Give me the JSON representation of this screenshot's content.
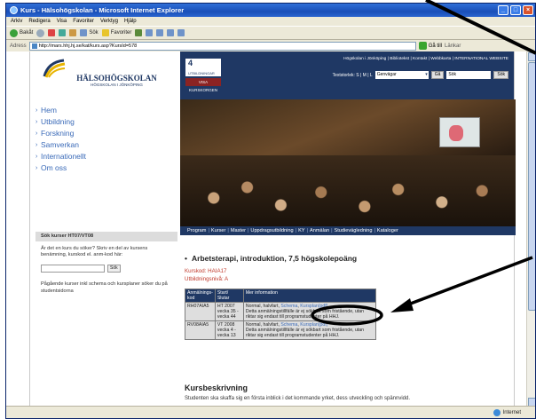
{
  "window": {
    "title": "Kurs - Hälsohögskolan - Microsoft Internet Explorer"
  },
  "menu": [
    "Arkiv",
    "Redigera",
    "Visa",
    "Favoriter",
    "Verktyg",
    "Hjälp"
  ],
  "toolbar": {
    "back": "Bakåt",
    "search": "Sök",
    "favorites": "Favoriter"
  },
  "addressbar": {
    "label": "Adress",
    "url": "http://mars.hhj.hj.se/kat/kurs.asp?KursId=578",
    "go": "Gå till",
    "links": "Länkar"
  },
  "header": {
    "logo_name": "HÄLSOHÖGSKOLAN",
    "logo_sub": "HÖGSKOLAN I JÖNKÖPING",
    "box_text": "4",
    "box_sub": "UTBILDNINGAR",
    "box2_text": "VISA KURSKORGEN",
    "toplinks": "Högskolan i Jönköping | Bibliotekst | Kontakt | Webbkarta | INTERNATIONAL WEBSITE",
    "textsize_label": "Textstorlek: S | M | L",
    "shortcut": "Genvägar",
    "go_button": "Gå",
    "search_value": "Sök",
    "search_button": "Sök"
  },
  "leftnav": [
    "Hem",
    "Utbildning",
    "Forskning",
    "Samverkan",
    "Internationellt",
    "Om oss"
  ],
  "subnav": [
    "Program",
    "Kurser",
    "Master",
    "Uppdragsutbildning",
    "KY",
    "Anmälan",
    "Studievägledning",
    "Kataloger"
  ],
  "sidebar": {
    "heading": "Sök kurser HT07/VT08",
    "text": "Är det en kurs du söker? Skriv en del av kursens benämning, kurskod el. anm-kod här:",
    "search_button": "Sök",
    "text2": "Pågående kurser inkl schema och kursplaner söker du på studentsidorna"
  },
  "course": {
    "title": "Arbetsterapi, introduktion, 7,5 högskolepoäng",
    "code": "Kurskod: HAIA17",
    "level": "Utbildningsnivå: A",
    "table_headers": [
      "Anmälnings-kod",
      "Start/ Slutar",
      "Mer information"
    ],
    "rows": [
      {
        "code": "RH07AIA5",
        "period": "HT 2007 vecka 35 - vecka 44",
        "info_prefix": "Normal, halvfart, ",
        "link_schema": "Schema",
        "link_kursplan": "Kursplan(pdf)",
        "info_text": "Detta anmälningstillfälle är ej sökbart som fristående, utan riktar sig endast till programstudenter på HHJ."
      },
      {
        "code": "RV08AIA5",
        "period": "VT 2008 vecka 4 - vecka 13",
        "info_prefix": "Normal, halvfart, ",
        "link_schema": "Schema",
        "link_kursplan": "Kursplan(pdf)",
        "info_text": "Detta anmälningstillfälle är ej sökbart som fristående, utan riktar sig endast till programstudenter på HHJ."
      }
    ],
    "desc_heading": "Kursbeskrivning",
    "desc_text": "Studenten ska skaffa sig en första inblick i det kommande yrket, dess utveckling och spännvidd."
  },
  "status": {
    "zone": "Internet"
  }
}
